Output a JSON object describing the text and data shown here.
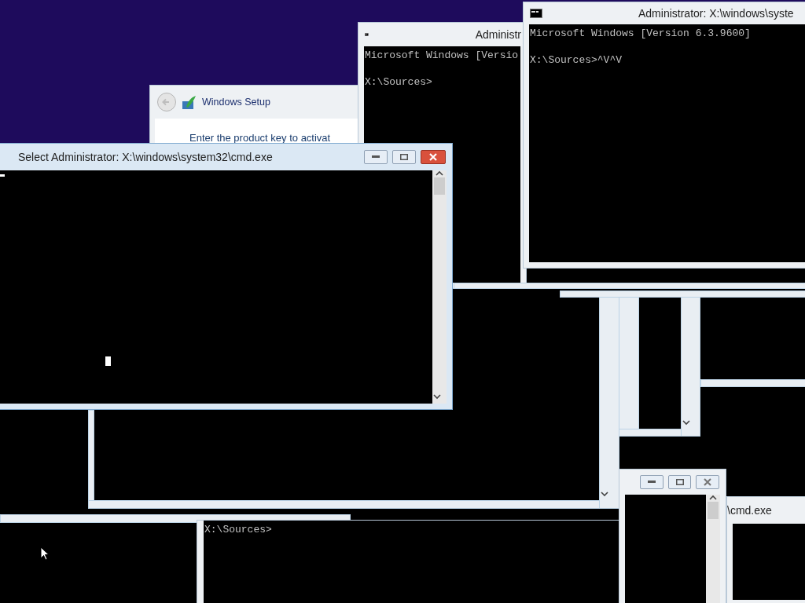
{
  "windows": [
    {
      "kind": "setup",
      "title": "Windows Setup",
      "text": "Enter the product key to activat"
    },
    {
      "kind": "console",
      "title": "Administr",
      "active": false,
      "lines": [
        "Microsoft Windows [Versio",
        "X:\\Sources>"
      ]
    },
    {
      "kind": "console",
      "title": "Administrator: X:\\windows\\syste",
      "active": false,
      "lines": [
        "Microsoft Windows [Version 6.3.9600]",
        "X:\\Sources>^V^V"
      ]
    },
    {
      "kind": "console",
      "title": "Select Administrator: X:\\windows\\system32\\cmd.exe",
      "active": true
    },
    {
      "kind": "console",
      "active": false
    },
    {
      "kind": "console",
      "title": "\\cmd.exe",
      "active": false
    },
    {
      "kind": "console",
      "active": false,
      "lines": [
        "X:\\Sources>"
      ]
    }
  ]
}
